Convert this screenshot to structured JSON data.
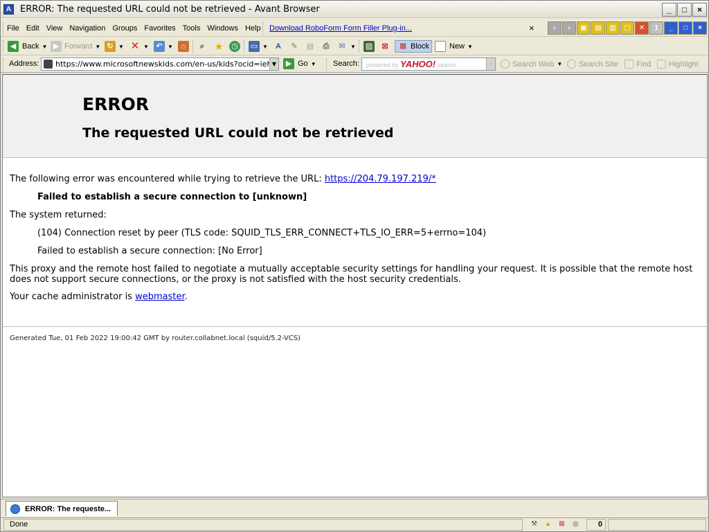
{
  "window": {
    "title": "ERROR: The requested URL could not be retrieved - Avant Browser",
    "app_icon_glyph": "A",
    "controls": {
      "minimize": "_",
      "maximize": "□",
      "close": "×"
    }
  },
  "menu": {
    "items": [
      "File",
      "Edit",
      "View",
      "Navigation",
      "Groups",
      "Favorites",
      "Tools",
      "Windows",
      "Help"
    ],
    "roboform_link": "Download RoboForm Form Filler Plug-in...",
    "roboform_close": "×",
    "tab_buttons": [
      "‹",
      "›",
      "▣",
      "▤",
      "▥",
      "▢",
      "✕",
      "1",
      "_",
      "□",
      "×"
    ]
  },
  "toolbar": {
    "back": "Back",
    "forward": "Forward",
    "block": "Block",
    "new": "New"
  },
  "address": {
    "label": "Address:",
    "url": "https://www.microsoftnewskids.com/en-us/kids?ocid=iehp",
    "go": "Go"
  },
  "search": {
    "label": "Search:",
    "powered_by": "powered by",
    "brand": "YAHOO!",
    "suffix": "search",
    "search_web": "Search Web",
    "search_site": "Search Site",
    "find": "Find",
    "highlight": "Highlight"
  },
  "page": {
    "heading": "ERROR",
    "subheading": "The requested URL could not be retrieved",
    "intro": "The following error was encountered while trying to retrieve the URL: ",
    "url_link": "https://204.79.197.219/*",
    "failed_bold": "Failed to establish a secure connection to [unknown]",
    "system_returned": "The system returned:",
    "error_code": "(104) Connection reset by peer (TLS code: SQUID_TLS_ERR_CONNECT+TLS_IO_ERR=5+errno=104)",
    "error_detail": "Failed to establish a secure connection: [No Error]",
    "explanation": "This proxy and the remote host failed to negotiate a mutually acceptable security settings for handling your request. It is possible that the remote host does not support secure connections, or the proxy is not satisfied with the host security credentials.",
    "admin_prefix": "Your cache administrator is ",
    "admin_link": "webmaster",
    "admin_suffix": ".",
    "generated": "Generated Tue, 01 Feb 2022 19:00:42 GMT by router.collabnet.local (squid/5.2-VCS)"
  },
  "tabs": [
    {
      "label": "ERROR: The requeste..."
    }
  ],
  "status": {
    "text": "Done",
    "popup_count": "0"
  }
}
